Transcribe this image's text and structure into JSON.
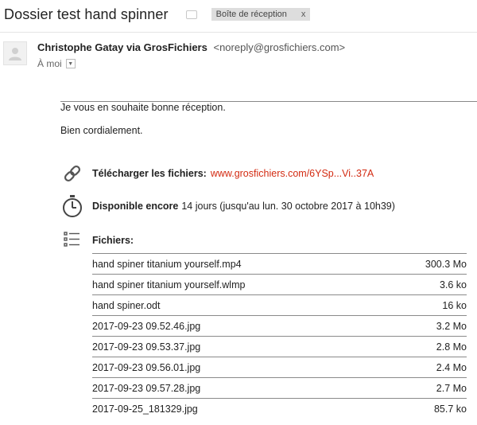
{
  "subject": "Dossier test hand spinner",
  "label_chip": {
    "text": "Boîte de réception",
    "close": "x"
  },
  "sender": {
    "name": "Christophe Gatay via GrosFichiers",
    "email": "<noreply@grosfichiers.com>",
    "to": "À moi",
    "dropdown_glyph": "▼"
  },
  "body": {
    "greeting": "Je vous en souhaite bonne réception.",
    "closing": "Bien cordialement.",
    "download": {
      "label": "Télécharger les fichiers:",
      "link": "www.grosfichiers.com/6YSp...Vi..37A"
    },
    "available": {
      "label": "Disponible encore",
      "text": "14 jours (jusqu'au lun. 30 octobre 2017 à 10h39)"
    },
    "files_label": "Fichiers:",
    "files": [
      {
        "name": "hand spiner titanium yourself.mp4",
        "size": "300.3 Mo"
      },
      {
        "name": "hand spiner titanium yourself.wlmp",
        "size": "3.6 ko"
      },
      {
        "name": "hand spiner.odt",
        "size": "16 ko"
      },
      {
        "name": "2017-09-23 09.52.46.jpg",
        "size": "3.2 Mo"
      },
      {
        "name": "2017-09-23 09.53.37.jpg",
        "size": "2.8 Mo"
      },
      {
        "name": "2017-09-23 09.56.01.jpg",
        "size": "2.4 Mo"
      },
      {
        "name": "2017-09-23 09.57.28.jpg",
        "size": "2.7 Mo"
      },
      {
        "name": "2017-09-25_181329.jpg",
        "size": "85.7 ko"
      }
    ]
  },
  "icons": {
    "avatar": "person-icon",
    "download": "link-chain-icon",
    "available": "stopwatch-icon",
    "files": "list-icon",
    "label": "label-tag-icon"
  },
  "colors": {
    "link": "#d32b12",
    "chip_bg": "#dddddd"
  }
}
